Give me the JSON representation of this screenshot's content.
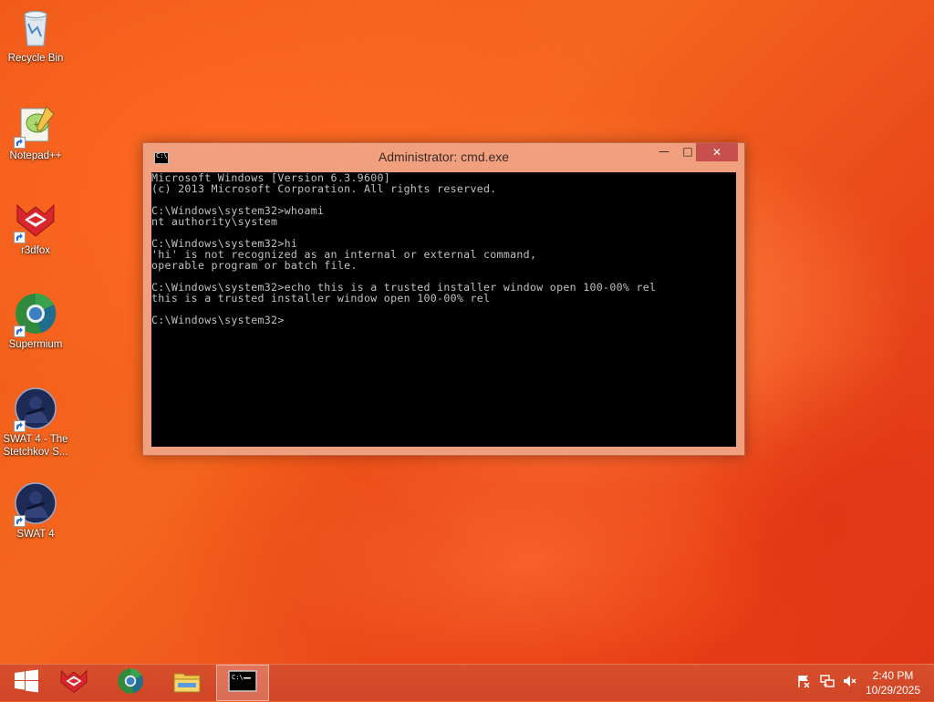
{
  "desktop": {
    "icons": [
      {
        "label": "Recycle Bin"
      },
      {
        "label": "Notepad++"
      },
      {
        "label": "r3dfox"
      },
      {
        "label": "Supermium"
      },
      {
        "label": "SWAT 4 - The Stetchkov S..."
      },
      {
        "label": "SWAT 4"
      }
    ]
  },
  "window": {
    "title": "Administrator: cmd.exe",
    "icon_text": "C:\\",
    "minimize_glyph": "—",
    "maximize_glyph": "□",
    "close_glyph": "✕",
    "console_lines": [
      "Microsoft Windows [Version 6.3.9600]",
      "(c) 2013 Microsoft Corporation. All rights reserved.",
      "",
      "C:\\Windows\\system32>whoami",
      "nt authority\\system",
      "",
      "C:\\Windows\\system32>hi",
      "'hi' is not recognized as an internal or external command,",
      "operable program or batch file.",
      "",
      "C:\\Windows\\system32>echo this is a trusted installer window open 100-00% rel",
      "this is a trusted installer window open 100-00% rel",
      "",
      "C:\\Windows\\system32>"
    ]
  },
  "taskbar": {
    "items": [
      {
        "icon": "windows-start-icon"
      },
      {
        "icon": "r3dfox-icon"
      },
      {
        "icon": "supermium-icon"
      },
      {
        "icon": "file-explorer-icon"
      },
      {
        "icon": "cmd-icon",
        "active": true
      }
    ],
    "tray": [
      {
        "icon": "action-center-flag-icon"
      },
      {
        "icon": "network-icon"
      },
      {
        "icon": "volume-muted-icon"
      }
    ],
    "clock": {
      "time": "2:40 PM",
      "date": "10/29/2025"
    }
  },
  "colors": {
    "accent": "#e85a1f",
    "window_frame": "#f0a07e",
    "close_button": "#c7504e",
    "console_bg": "#000000",
    "console_text": "#c0c0c0"
  }
}
